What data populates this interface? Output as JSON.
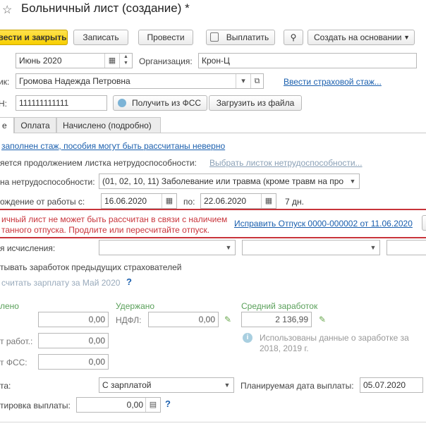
{
  "window": {
    "title": "Больничный лист (создание) *"
  },
  "toolbar": {
    "post_close": "вести и закрыть",
    "save": "Записать",
    "post": "Провести",
    "pay": "Выплатить",
    "create_based": "Создать на основании"
  },
  "header": {
    "month_value": "Июнь 2020",
    "org_label": "Организация:",
    "org_value": "Крон-Ц",
    "employee_label": "ик:",
    "employee_value": "Громова Надежда Петровна",
    "insurance_link": "Ввести страховой стаж...",
    "snils_label": "Н:",
    "snils_value": "111111111111",
    "get_fss": "Получить из ФСС",
    "load_file": "Загрузить из файла"
  },
  "tabs": [
    {
      "label": "е"
    },
    {
      "label": "Оплата"
    },
    {
      "label": "Начислено (подробно)"
    }
  ],
  "main": {
    "warning_link": "заполнен стаж, пособия могут быть рассчитаны неверно",
    "continuation_label": "яется продолжением листка нетрудоспособности:",
    "continuation_link": "Выбрать листок нетрудоспособности...",
    "reason_label": "на нетрудоспособности:",
    "reason_value": "(01, 02, 10, 11) Заболевание или травма (кроме травм на про",
    "release_label": "ождение от работы с:",
    "date_from": "16.06.2020",
    "to_label": "по:",
    "date_to": "22.06.2020",
    "days": "7 дн."
  },
  "alert": {
    "line1": "ичный лист не может быть рассчитан в связи с наличием",
    "line2": "танного отпуска. Продлите или пересчитайте отпуск.",
    "fix_link": "Исправить Отпуск 0000-000002 от 11.06.2020"
  },
  "calc": {
    "period_label": "я исчисления:",
    "prev_insurers": "тывать заработок предыдущих страхователей",
    "recalc_link": "считать зарплату за Май 2020",
    "q": "?"
  },
  "amounts": {
    "accrued_header": "лено",
    "accrued_value": "0,00",
    "withheld_header": "Удержано",
    "ndfl_label": "НДФЛ:",
    "ndfl_value": "0,00",
    "avg_header": "Средний заработок",
    "avg_value": "2 136,99",
    "employer_label": "т работ.:",
    "employer_value": "0,00",
    "fss_label": "т ФСС:",
    "fss_value": "0,00",
    "note_line1": "Использованы данные о заработке за",
    "note_line2": "2018,  2019 г."
  },
  "payment": {
    "pay_label": "та:",
    "pay_value": "С зарплатой",
    "planned_label": "Планируемая дата выплаты:",
    "planned_value": "05.07.2020",
    "adjust_label": "тировка выплаты:",
    "adjust_value": "0,00"
  }
}
